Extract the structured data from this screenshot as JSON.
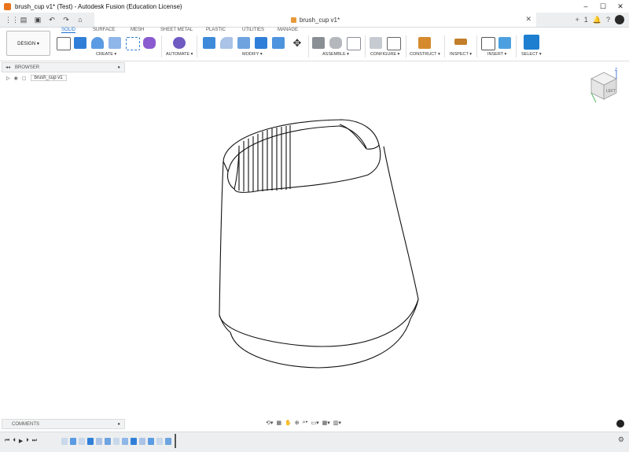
{
  "window": {
    "title": "brush_cup v1* (Test) - Autodesk Fusion (Education License)",
    "min": "–",
    "max": "☐",
    "close": "✕"
  },
  "document": {
    "tab_title": "brush_cup v1*",
    "close": "✕"
  },
  "qat": {
    "grid": "⋮⋮",
    "file": "▤",
    "save": "▣",
    "undo": "↶",
    "redo": "↷",
    "home": "⌂"
  },
  "qright": {
    "new_tab": "+",
    "notifications": "🔔",
    "help": "?",
    "job_count": "1"
  },
  "workspace": {
    "label": "DESIGN ▾"
  },
  "tabs": [
    "SOLID",
    "SURFACE",
    "MESH",
    "SHEET METAL",
    "PLASTIC",
    "UTILITIES",
    "MANAGE"
  ],
  "active_tab": "SOLID",
  "groups": [
    "CREATE ▾",
    "AUTOMATE ▾",
    "MODIFY ▾",
    "ASSEMBLE ▾",
    "CONFIGURE ▾",
    "CONSTRUCT ▾",
    "INSPECT ▾",
    "INSERT ▾",
    "SELECT ▾"
  ],
  "browser": {
    "title": "BROWSER",
    "collapse": "◂◂",
    "pin": "●",
    "component": "brush_cup v1"
  },
  "comments": {
    "title": "COMMENTS",
    "pin": "●"
  },
  "viewcube": {
    "face_label": "LEFT",
    "axis_z": "Z",
    "axis_y": "Y"
  },
  "timeline": {
    "first": "⏮",
    "prev": "⏴",
    "play": "▶",
    "next": "⏵",
    "last": "⏭"
  },
  "navbar": {
    "orbit": "⟲▾",
    "look": "▦",
    "pan": "✋",
    "zoom": "⊕",
    "fit": "⌕▾",
    "display": "▭▾",
    "grid": "▦▾",
    "viewports": "▥▾"
  },
  "colors": {
    "accent": "#1b6fd0",
    "create": "#2f7fd8",
    "automate": "#6f5bc1",
    "assemble": "#8a8f96",
    "construct": "#d48a2d",
    "inspect": "#c27e2a",
    "select": "#1e7fd0"
  }
}
